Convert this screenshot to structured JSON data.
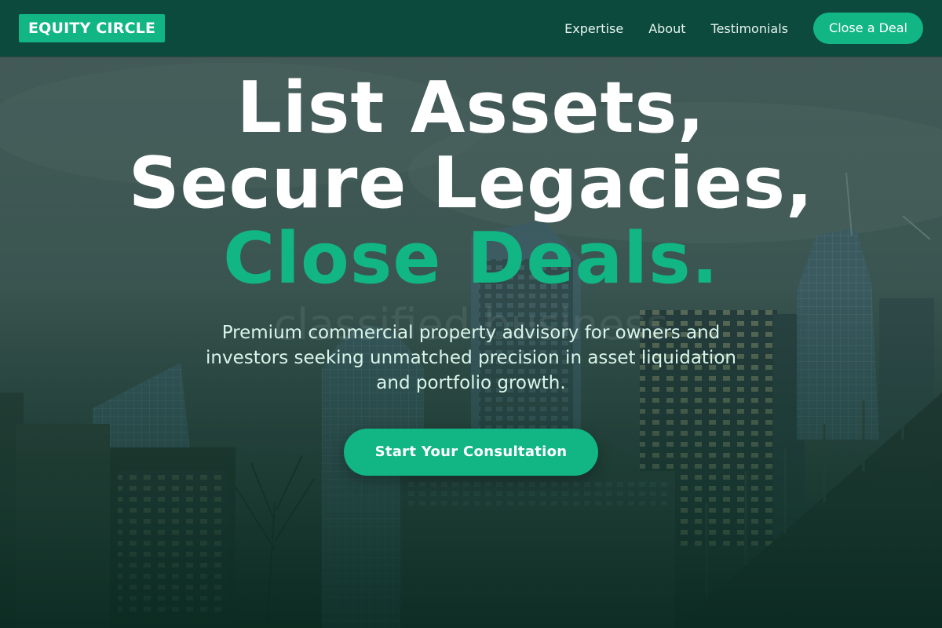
{
  "brand": {
    "logo_text": "EQUITY CIRCLE"
  },
  "nav": {
    "links": [
      "Expertise",
      "About",
      "Testimonials"
    ],
    "cta_label": "Close a Deal"
  },
  "hero": {
    "headline_main": "List Assets, Secure Legacies,",
    "headline_accent": "Close Deals.",
    "watermark": "classified business",
    "subtitle": "Premium commercial property advisory for owners and investors seeking unmatched precision in asset liquidation and portfolio growth.",
    "cta_label": "Start Your Consultation"
  },
  "colors": {
    "accent": "#12b584",
    "navbar": "#0b4a3c",
    "subtitle_text": "#d9f5ea"
  }
}
